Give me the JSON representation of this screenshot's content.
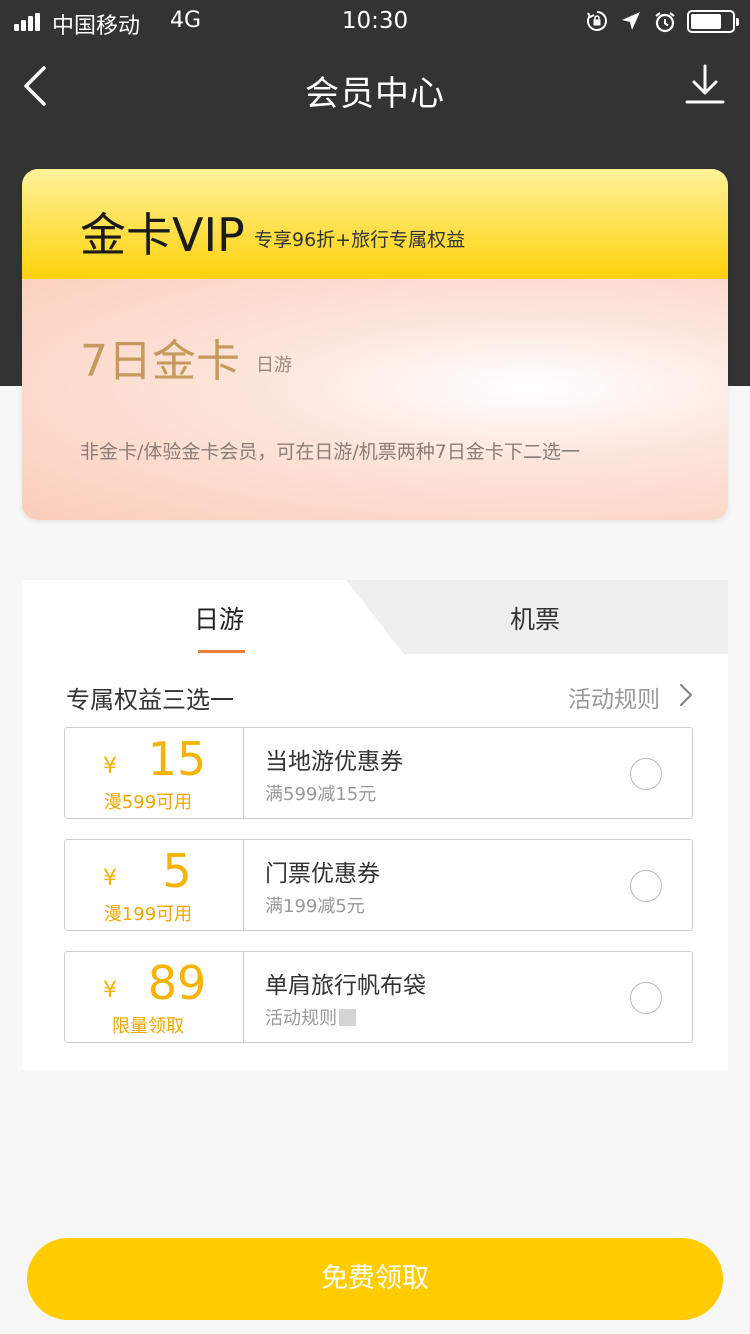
{
  "status_bar": {
    "carrier": "中国移动",
    "network": "4G",
    "time": "10:30",
    "icons": [
      "orientation-lock-icon",
      "location-icon",
      "alarm-icon",
      "battery-icon"
    ]
  },
  "nav": {
    "title": "会员中心",
    "back_icon": "chevron-left-icon",
    "download_icon": "download-icon"
  },
  "vip_card": {
    "title": "金卡VIP",
    "subtitle": "专享96折+旅行专属权益",
    "pass_title": "7日金卡",
    "pass_tag": "日游",
    "note": "非金卡/体验金卡会员，可在日游/机票两种7日金卡下二选一"
  },
  "tabs": [
    {
      "label": "日游",
      "active": true
    },
    {
      "label": "机票",
      "active": false
    }
  ],
  "benefits": {
    "title": "专属权益三选一",
    "rules_label": "活动规则",
    "items": [
      {
        "currency": "¥",
        "amount": "15",
        "condition": "漫599可用",
        "name": "当地游优惠券",
        "desc": "满599减15元"
      },
      {
        "currency": "¥",
        "amount": "5",
        "condition": "漫199可用",
        "name": "门票优惠券",
        "desc": "满199减5元"
      },
      {
        "currency": "¥",
        "amount": "89",
        "condition": "限量领取",
        "name": "单肩旅行帆布袋",
        "desc": "活动规则"
      }
    ]
  },
  "cta_label": "免费领取",
  "colors": {
    "header_bg": "#333333",
    "accent_yellow": "#ffcc00",
    "coupon_amount": "#f5b400",
    "tab_underline": "#ec7d3a",
    "gold_text": "#c59a5c"
  }
}
